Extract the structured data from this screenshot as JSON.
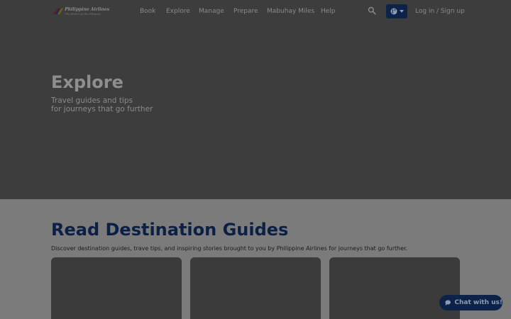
{
  "header": {
    "logo": {
      "name": "Philippine Airlines",
      "tagline": "The Heart of the Filipino"
    },
    "nav": [
      "Book",
      "Explore",
      "Manage",
      "Prepare",
      "Mabuhay Miles",
      "Help"
    ],
    "icons": {
      "search": "search-icon",
      "language": "globe-icon",
      "caret": "caret-down-icon"
    },
    "login_label": "Log in / Sign up"
  },
  "hero": {
    "title": "Explore",
    "subtitle_line1": "Travel guides and tips",
    "subtitle_line2": "for journeys that go further"
  },
  "guides": {
    "title": "Read Destination Guides",
    "description": "Discover destination guides, trave tips, and inspiring stories brought to you by Philippine Airlines for journeys that go further."
  },
  "chat": {
    "label": "Chat with us!",
    "icon": "chat-bubble-icon"
  },
  "colors": {
    "brand_navy": "#0c2249",
    "heading_navy": "#0c1f44",
    "overlay_dark": "#3d3d3d",
    "page_bg": "#7b7b7b"
  }
}
